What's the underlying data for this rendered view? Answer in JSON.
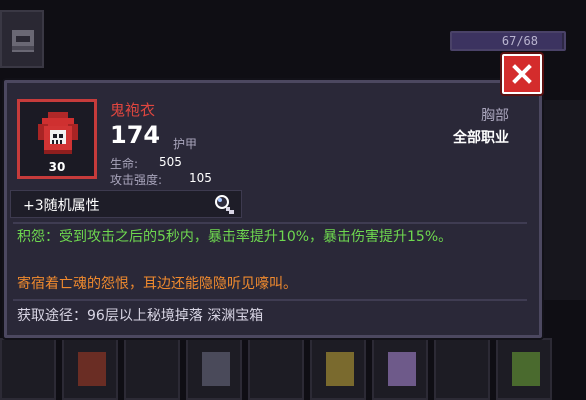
{
  "background": {
    "top_bar": {
      "text": "67/68",
      "progress": 0.985
    },
    "bottom_slots_count": 9
  },
  "tooltip": {
    "item_name": "鬼袍衣",
    "main_value": "174",
    "main_label": "护甲",
    "stats": [
      {
        "label": "生命:",
        "value": "505"
      },
      {
        "label": "攻击强度:",
        "value": "105"
      }
    ],
    "level": "30",
    "slot": "胸部",
    "class_req": "全部职业",
    "random_attr_label": "+3随机属性",
    "effect": "积怨：受到攻击之后的5秒内，暴击率提升10%，暴击伤害提升15%。",
    "lore": "寄宿着亡魂的怨恨，耳边还能隐隐听见嚎叫。",
    "source": "获取途径：96层以上秘境掉落 深渊宝箱"
  },
  "colors": {
    "item_name": "#e0463f",
    "effect": "#6ed84f",
    "lore": "#f08a2e",
    "close_button": "#d42c2c",
    "icon_border": "#c63b3b"
  },
  "icons": {
    "item_icon": "red-robe-skull-icon",
    "close": "close-icon",
    "magnifier": "magnifier-icon",
    "top_left": "helmet-icon"
  }
}
